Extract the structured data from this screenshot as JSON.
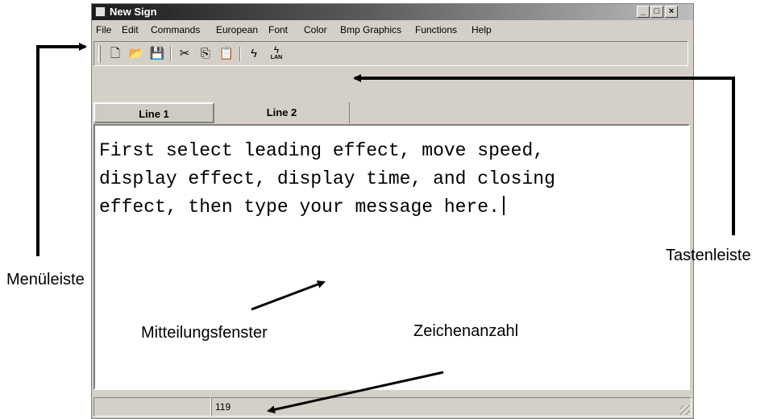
{
  "window": {
    "title": "New Sign",
    "controls": {
      "minimize": "_",
      "maximize": "□",
      "close": "×"
    }
  },
  "menubar": {
    "items": [
      "File",
      "Edit",
      "Commands",
      "European",
      "Font",
      "Color",
      "Bmp Graphics",
      "Functions",
      "Help"
    ]
  },
  "toolbar": {
    "buttons": [
      "new-file",
      "open-folder",
      "save",
      "cut",
      "copy",
      "paste",
      "send",
      "lan"
    ],
    "lan_label": "LAN"
  },
  "tabs": [
    "Line 1",
    "Line 2"
  ],
  "editor": {
    "text": "First select leading effect, move speed,\ndisplay effect, display time, and closing\neffect, then type your message here."
  },
  "statusbar": {
    "char_count": "119"
  },
  "callouts": {
    "menubar": "Menüleiste",
    "toolbar": "Tastenleiste",
    "message_window": "Mitteilungsfenster",
    "char_count": "Zeichenanzahl"
  }
}
